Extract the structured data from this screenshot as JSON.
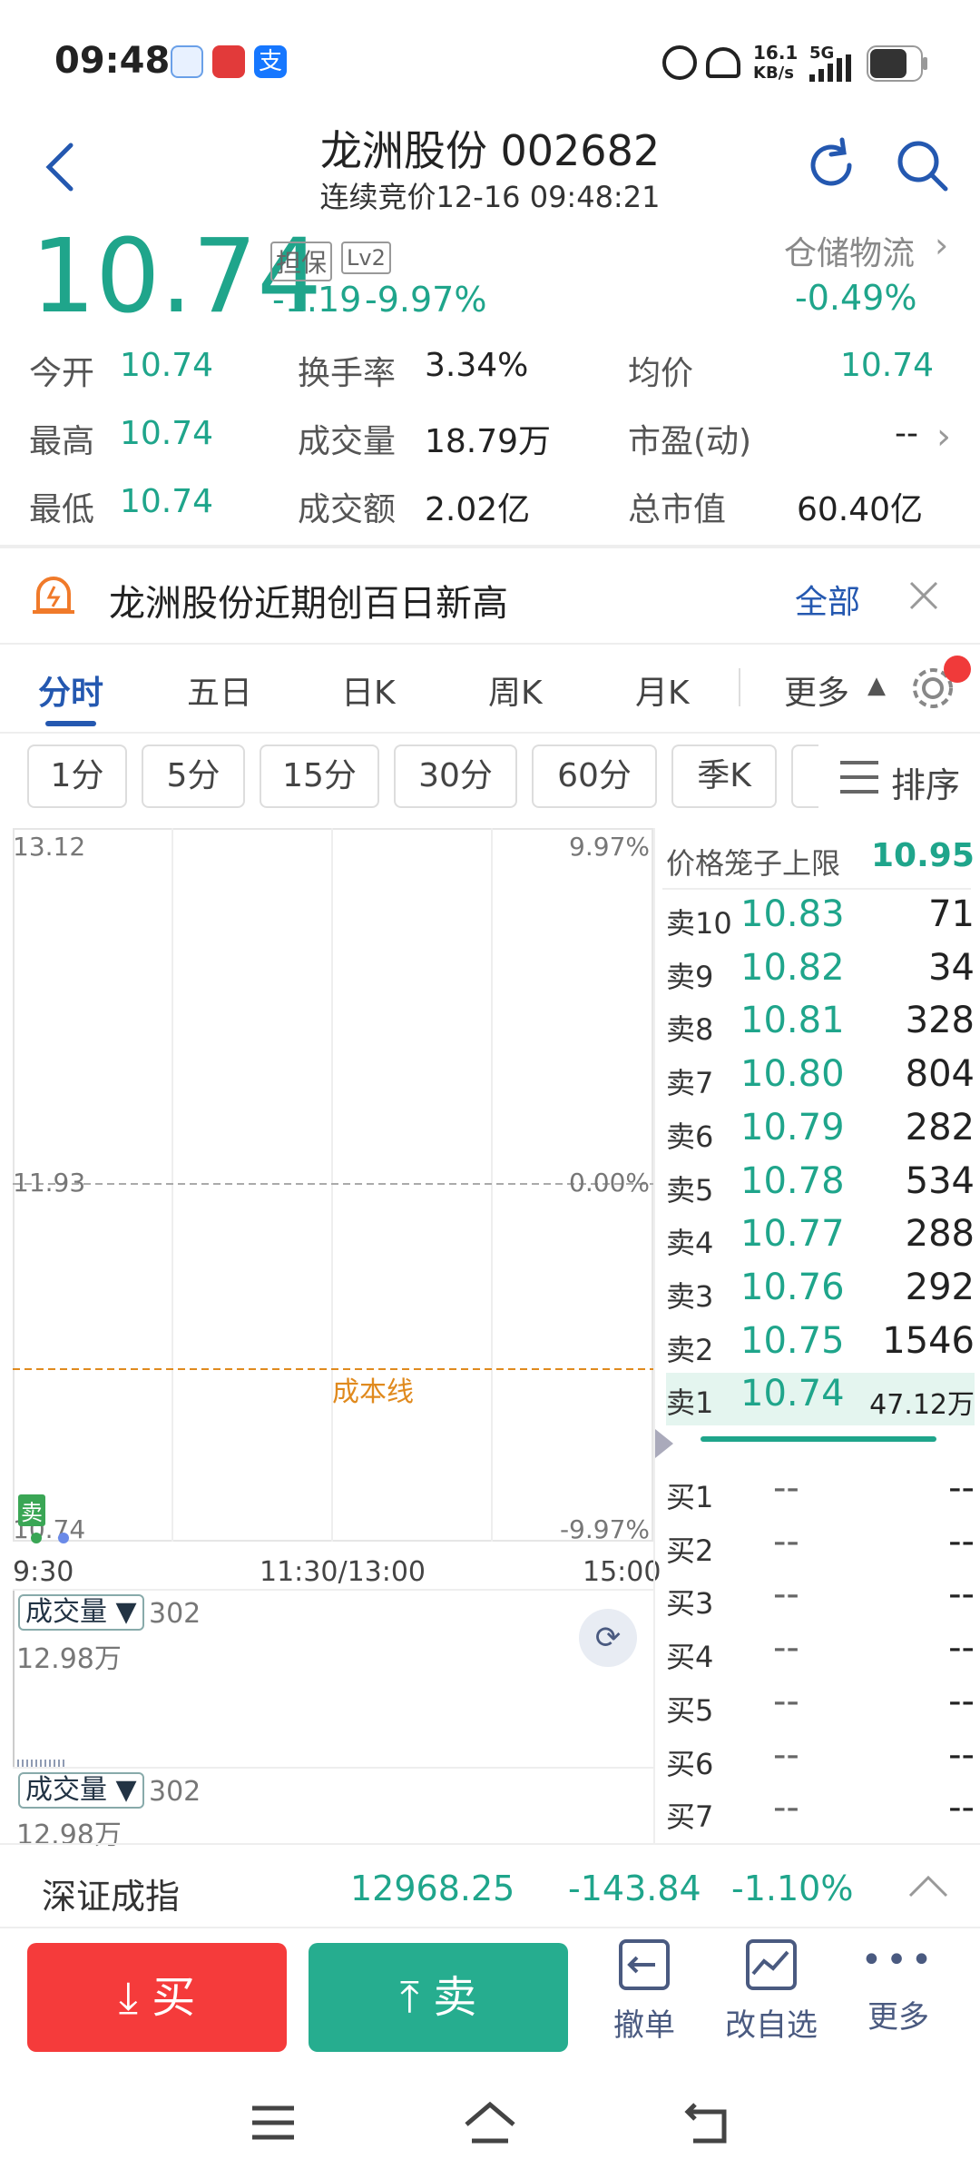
{
  "status": {
    "time": "09:48",
    "speed_top": "16.1",
    "speed_bot": "KB/s",
    "net": "5G"
  },
  "header": {
    "title": "龙洲股份 002682",
    "subtitle": "连续竞价12-16 09:48:21"
  },
  "quote": {
    "price": "10.74",
    "tag1": "担保",
    "tag2": "Lv2",
    "change": "-1.19",
    "change_pct": "-9.97%",
    "sector": "仓储物流",
    "sector_pct": "-0.49%"
  },
  "stats": {
    "open_l": "今开",
    "open_v": "10.74",
    "turn_l": "换手率",
    "turn_v": "3.34%",
    "avg_l": "均价",
    "avg_v": "10.74",
    "high_l": "最高",
    "high_v": "10.74",
    "vol_l": "成交量",
    "vol_v": "18.79万",
    "pe_l": "市盈(动)",
    "pe_v": "--",
    "low_l": "最低",
    "low_v": "10.74",
    "amt_l": "成交额",
    "amt_v": "2.02亿",
    "cap_l": "总市值",
    "cap_v": "60.40亿"
  },
  "news": {
    "text": "龙洲股份近期创百日新高",
    "all": "全部"
  },
  "tabs": [
    "分时",
    "五日",
    "日K",
    "周K",
    "月K",
    "更多"
  ],
  "chips": [
    "1分",
    "5分",
    "15分",
    "30分",
    "60分",
    "季K"
  ],
  "sort": "排序",
  "chart": {
    "y_top": "13.12",
    "y_mid": "11.93",
    "y_bot": "10.74",
    "pct_top": "9.97%",
    "pct_mid": "0.00%",
    "pct_bot": "-9.97%",
    "cost_line": "成本线",
    "sell_tag": "卖",
    "x_start": "9:30",
    "x_mid": "11:30/13:00",
    "x_end": "15:00"
  },
  "volume": {
    "label": "成交量 ▼",
    "value": "302",
    "max": "12.98万"
  },
  "book": {
    "cage_label": "价格笼子上限",
    "cage_value": "10.95",
    "asks": [
      {
        "k": "卖10",
        "p": "10.83",
        "v": "71"
      },
      {
        "k": "卖9",
        "p": "10.82",
        "v": "34"
      },
      {
        "k": "卖8",
        "p": "10.81",
        "v": "328"
      },
      {
        "k": "卖7",
        "p": "10.80",
        "v": "804"
      },
      {
        "k": "卖6",
        "p": "10.79",
        "v": "282"
      },
      {
        "k": "卖5",
        "p": "10.78",
        "v": "534"
      },
      {
        "k": "卖4",
        "p": "10.77",
        "v": "288"
      },
      {
        "k": "卖3",
        "p": "10.76",
        "v": "292"
      },
      {
        "k": "卖2",
        "p": "10.75",
        "v": "1546"
      },
      {
        "k": "卖1",
        "p": "10.74",
        "v": "47.12万"
      }
    ],
    "bids": [
      {
        "k": "买1",
        "p": "--",
        "v": "--"
      },
      {
        "k": "买2",
        "p": "--",
        "v": "--"
      },
      {
        "k": "买3",
        "p": "--",
        "v": "--"
      },
      {
        "k": "买4",
        "p": "--",
        "v": "--"
      },
      {
        "k": "买5",
        "p": "--",
        "v": "--"
      },
      {
        "k": "买6",
        "p": "--",
        "v": "--"
      },
      {
        "k": "买7",
        "p": "--",
        "v": "--"
      }
    ]
  },
  "index": {
    "name": "深证成指",
    "value": "12968.25",
    "change": "-143.84",
    "pct": "-1.10%"
  },
  "actions": {
    "buy": "买",
    "sell": "卖",
    "cancel": "撤单",
    "watch": "改自选",
    "more": "更多"
  },
  "colors": {
    "up": "#f03a3a",
    "down": "#1fa58b",
    "accent": "#2458b0"
  }
}
